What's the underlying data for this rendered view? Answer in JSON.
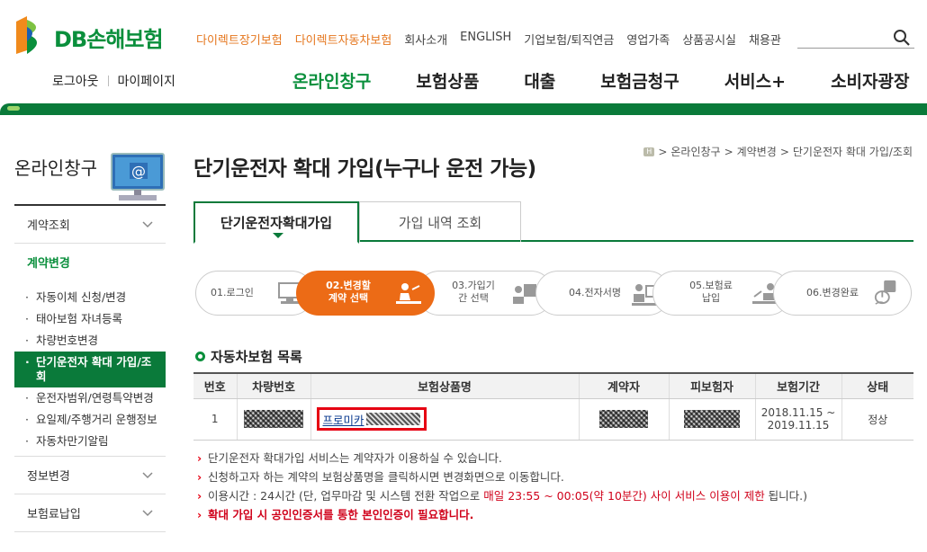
{
  "brand": {
    "name": "DB손해보험"
  },
  "util_nav": [
    {
      "label": "다이렉트장기보험",
      "accent": true
    },
    {
      "label": "다이렉트자동차보험",
      "accent": true
    },
    {
      "label": "회사소개",
      "accent": false
    },
    {
      "label": "ENGLISH",
      "accent": false
    },
    {
      "label": "기업보험/퇴직연금",
      "accent": false
    },
    {
      "label": "영업가족",
      "accent": false
    },
    {
      "label": "상품공시실",
      "accent": false
    },
    {
      "label": "채용관",
      "accent": false
    }
  ],
  "search": {
    "placeholder": ""
  },
  "account": {
    "logout": "로그아웃",
    "mypage": "마이페이지"
  },
  "gnb": [
    {
      "label": "온라인창구",
      "active": true
    },
    {
      "label": "보험상품",
      "active": false
    },
    {
      "label": "대출",
      "active": false
    },
    {
      "label": "보험금청구",
      "active": false
    },
    {
      "label": "서비스+",
      "active": false
    },
    {
      "label": "소비자광장",
      "active": false
    }
  ],
  "sidebar": {
    "title": "온라인창구",
    "sections": [
      {
        "label": "계약조회"
      },
      {
        "label": "계약변경"
      }
    ],
    "sub_items": [
      {
        "label": "자동이체 신청/변경",
        "active": false
      },
      {
        "label": "태아보험 자녀등록",
        "active": false
      },
      {
        "label": "차량번호변경",
        "active": false
      },
      {
        "label": "단기운전자 확대 가입/조회",
        "active": true
      },
      {
        "label": "운전자범위/연령특약변경",
        "active": false
      },
      {
        "label": "요일제/주행거리 운행정보",
        "active": false
      },
      {
        "label": "자동차만기알림",
        "active": false
      }
    ],
    "bottom_sections": [
      {
        "label": "정보변경"
      },
      {
        "label": "보험료납입"
      }
    ]
  },
  "breadcrumb": [
    "온라인창구",
    "계약변경",
    "단기운전자 확대 가입/조회"
  ],
  "page_title": "단기운전자 확대 가입(누구나 운전 가능)",
  "tabs": [
    {
      "label": "단기운전자확대가입",
      "active": true
    },
    {
      "label": "가입 내역 조회",
      "active": false
    }
  ],
  "steps": [
    {
      "label": "01.로그인",
      "active": false
    },
    {
      "label": "02.변경할 계약 선택",
      "active": true
    },
    {
      "label": "03.가입기간 선택",
      "active": false
    },
    {
      "label": "04.전자서명",
      "active": false
    },
    {
      "label": "05.보험료 납입",
      "active": false
    },
    {
      "label": "06.변경완료",
      "active": false
    }
  ],
  "section_title": "자동차보험 목록",
  "table": {
    "headers": [
      "번호",
      "차량번호",
      "보험상품명",
      "계약자",
      "피보험자",
      "보험기간",
      "상태"
    ],
    "rows": [
      {
        "no": "1",
        "product_prefix": "프로미카",
        "period_start": "2018.11.15 ~",
        "period_end": "2019.11.15",
        "status": "정상"
      }
    ]
  },
  "notes": [
    {
      "text": "단기운전자 확대가입 서비스는 계약자가 이용하실 수 있습니다."
    },
    {
      "text": "신청하고자 하는 계약의 보험상품명을 클릭하시면 변경화면으로 이동합니다."
    },
    {
      "text_before": "이용시간 : 24시간 (단, 업무마감 및 시스템 전환 작업으로 ",
      "text_red": "매일 23:55 ~ 00:05(약 10분간) 사이 서비스 이용이 제한",
      "text_after": " 됩니다.)"
    },
    {
      "text": "확대 가입 시 공인인증서를 통한 본인인증이 필요합니다."
    }
  ],
  "colors": {
    "brand_green": "#0a7a3a",
    "accent_orange": "#ec6b16",
    "alert_red": "#d0021b"
  }
}
